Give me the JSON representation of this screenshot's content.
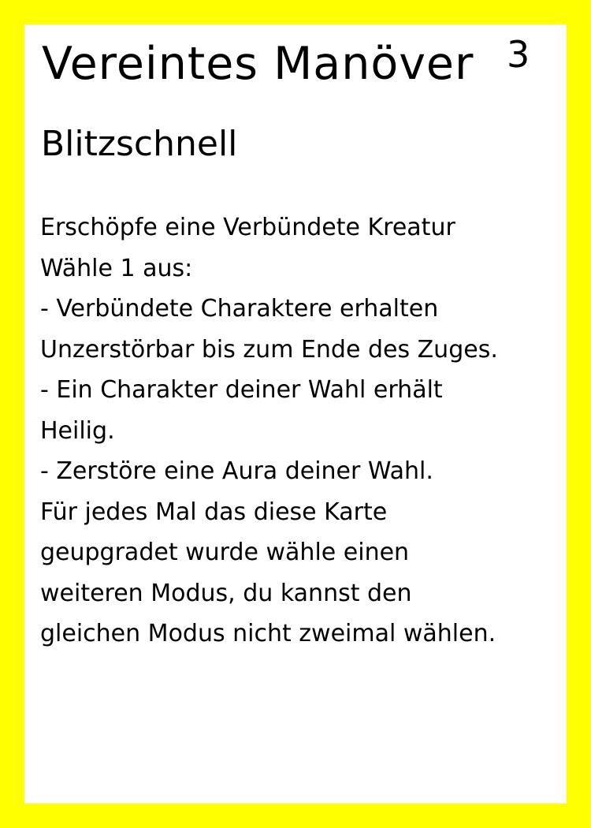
{
  "card": {
    "title": "Vereintes Manöver",
    "cost": "3",
    "subtitle": "Blitzschnell",
    "lines": [
      "Erschöpfe eine Verbündete Kreatur",
      "Wähle 1 aus:",
      "- Verbündete Charaktere erhalten",
      "Unzerstörbar bis zum Ende des Zuges.",
      "- Ein Charakter deiner Wahl erhält",
      "Heilig.",
      "- Zerstöre eine Aura deiner Wahl.",
      "Für jedes Mal das diese Karte",
      "geupgradet wurde wähle einen",
      "weiteren Modus, du kannst den",
      "gleichen Modus nicht zweimal wählen."
    ]
  },
  "colors": {
    "border": "#ffff00",
    "card_background": "#ffffff",
    "text": "#000000"
  }
}
